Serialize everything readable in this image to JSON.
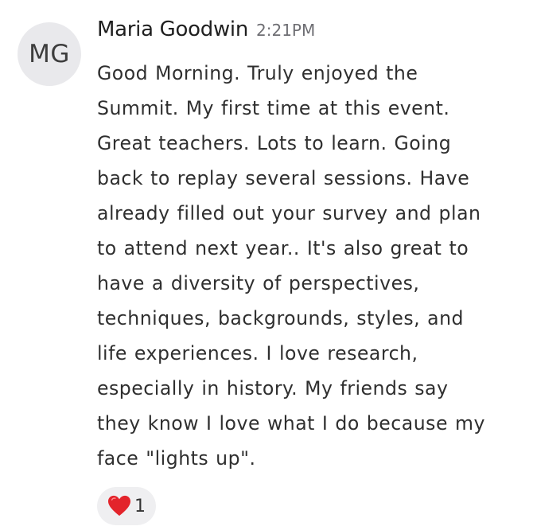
{
  "message": {
    "avatar_initials": "MG",
    "author": "Maria Goodwin",
    "time": "2:21PM",
    "lines": [
      "Good Morning. Truly enjoyed the",
      "Summit. My first time at this event.",
      "Great teachers. Lots to learn. Going",
      "back to replay several sessions. Have",
      "already filled out your survey and plan",
      "to attend next year.. It's also great to",
      "have a diversity of perspectives,",
      "techniques, backgrounds, styles, and",
      "life experiences. I love research,",
      "especially in history. My friends say",
      "they know I love what I do because my",
      "face \"lights up\"."
    ],
    "reaction": {
      "icon": "heart-icon",
      "count": "1",
      "color": "#e3242b"
    }
  }
}
